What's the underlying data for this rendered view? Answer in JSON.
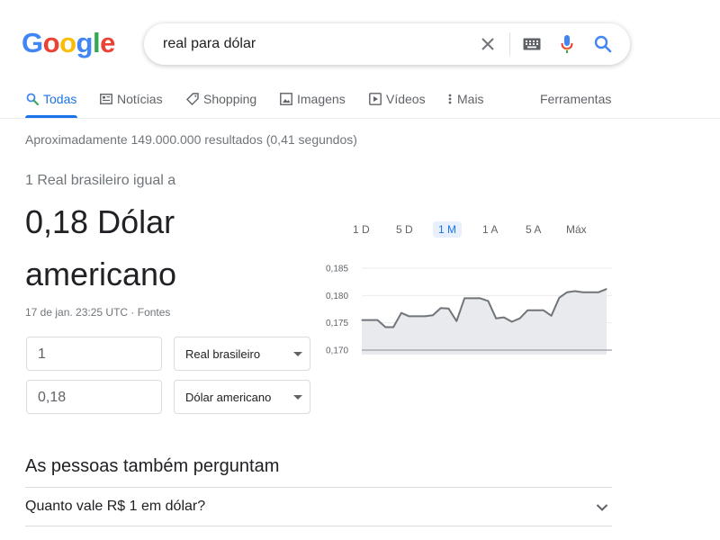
{
  "logo": {
    "letters": [
      {
        "ch": "G",
        "color": "#4285F4"
      },
      {
        "ch": "o",
        "color": "#EA4335"
      },
      {
        "ch": "o",
        "color": "#FBBC05"
      },
      {
        "ch": "g",
        "color": "#4285F4"
      },
      {
        "ch": "l",
        "color": "#34A853"
      },
      {
        "ch": "e",
        "color": "#EA4335"
      }
    ]
  },
  "search": {
    "query": "real para dólar"
  },
  "tabs": {
    "all": "Todas",
    "news": "Notícias",
    "shopping": "Shopping",
    "images": "Imagens",
    "videos": "Vídeos",
    "more": "Mais",
    "tools": "Ferramentas"
  },
  "result_stats": "Aproximadamente 149.000.000 resultados (0,41 segundos)",
  "converter": {
    "label": "1 Real brasileiro igual a",
    "value": "0,18 Dólar americano",
    "date": "17 de jan. 23:25 UTC · Fontes",
    "from_amount": "1",
    "from_currency": "Real brasileiro",
    "to_amount": "0,18",
    "to_currency": "Dólar americano"
  },
  "ranges": [
    "1 D",
    "5 D",
    "1 M",
    "1 A",
    "5 A",
    "Máx"
  ],
  "active_range": "1 M",
  "chart_data": {
    "type": "area",
    "y_ticks": [
      "0,185",
      "0,180",
      "0,175",
      "0,170"
    ],
    "ylim": [
      0.17,
      0.185
    ],
    "baseline": 0.17,
    "values": [
      0.1755,
      0.1755,
      0.1755,
      0.1742,
      0.1742,
      0.1768,
      0.1762,
      0.1762,
      0.1762,
      0.1764,
      0.1777,
      0.1776,
      0.1753,
      0.1795,
      0.1795,
      0.1795,
      0.179,
      0.1758,
      0.176,
      0.1752,
      0.1758,
      0.1773,
      0.1773,
      0.1773,
      0.1763,
      0.1796,
      0.1806,
      0.1808,
      0.1806,
      0.1806,
      0.1806,
      0.1812
    ]
  },
  "people_also_ask": {
    "title": "As pessoas também perguntam",
    "questions": [
      "Quanto vale R$ 1 em dólar?"
    ]
  },
  "colors": {
    "accent": "#1a73e8",
    "line": "#70757a",
    "area": "#e8eaed"
  }
}
